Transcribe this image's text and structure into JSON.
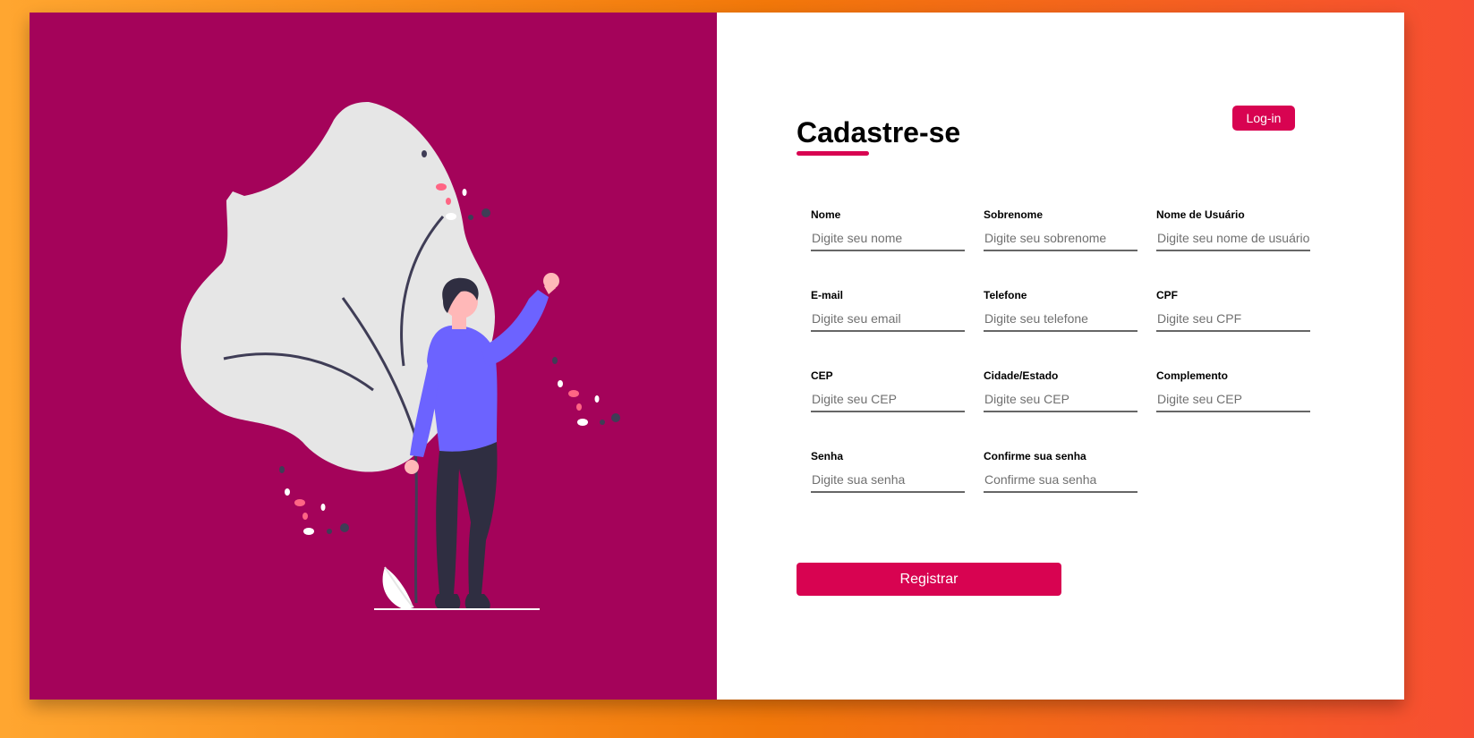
{
  "colors": {
    "panel": "#a4035a",
    "accent": "#d80351",
    "figure_shirt": "#6c63ff",
    "leaf": "#e6e6e6",
    "dark": "#2f2e41"
  },
  "illustration": {
    "icon": "person-waving-with-plant-illustration"
  },
  "form": {
    "title": "Cadastre-se",
    "login_label": "Log-in",
    "register_label": "Registrar",
    "fields": [
      {
        "label": "Nome",
        "placeholder": "Digite seu nome"
      },
      {
        "label": "Sobrenome",
        "placeholder": "Digite seu sobrenome"
      },
      {
        "label": "Nome de Usuário",
        "placeholder": "Digite seu nome de usuário"
      },
      {
        "label": "E-mail",
        "placeholder": "Digite seu email"
      },
      {
        "label": "Telefone",
        "placeholder": "Digite seu telefone"
      },
      {
        "label": "CPF",
        "placeholder": "Digite seu CPF"
      },
      {
        "label": "CEP",
        "placeholder": "Digite seu CEP"
      },
      {
        "label": "Cidade/Estado",
        "placeholder": "Digite seu CEP"
      },
      {
        "label": "Complemento",
        "placeholder": "Digite seu CEP"
      },
      {
        "label": "Senha",
        "placeholder": "Digite sua senha"
      },
      {
        "label": "Confirme sua senha",
        "placeholder": "Confirme sua senha"
      }
    ]
  }
}
